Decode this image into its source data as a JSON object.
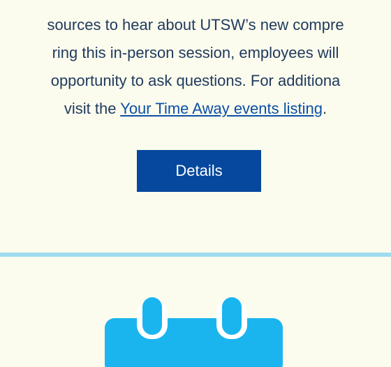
{
  "description": {
    "line1": "sources to hear about UTSW’s new compre",
    "line2": "ring this in-person session, employees will",
    "line3": " opportunity to ask questions. For additiona",
    "line4_before": "visit the ",
    "line4_link": "Your Time Away events listing",
    "line4_after": "."
  },
  "details_button": {
    "label": "Details"
  },
  "colors": {
    "background": "#fbfbee",
    "button": "#05489d",
    "divider": "#9ddcef",
    "icon": "#1ab5ef",
    "link": "#0b4fa6"
  },
  "icon": "calendar-icon"
}
